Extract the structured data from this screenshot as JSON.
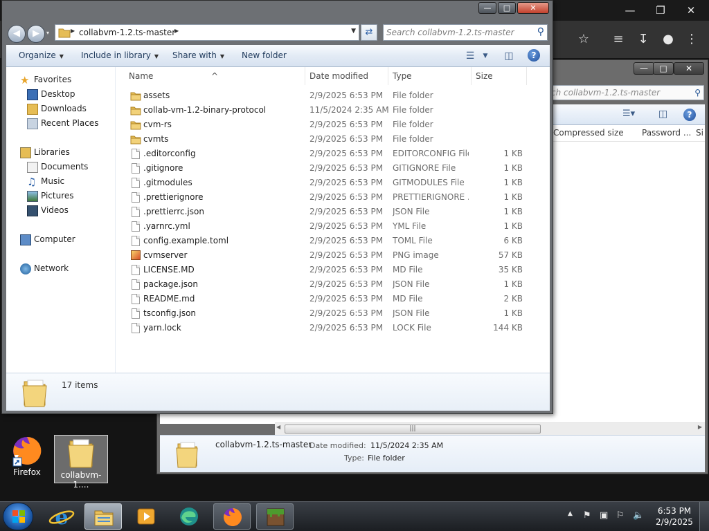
{
  "window": {
    "breadcrumb": "collabvm-1.2.ts-master",
    "search_placeholder": "Search collabvm-1.2.ts-master"
  },
  "toolbar": {
    "organize": "Organize",
    "include_in_library": "Include in library",
    "share_with": "Share with",
    "new_folder": "New folder",
    "help": "?"
  },
  "sidebar": {
    "favorites": "Favorites",
    "desktop": "Desktop",
    "downloads": "Downloads",
    "recent_places": "Recent Places",
    "libraries": "Libraries",
    "documents": "Documents",
    "music": "Music",
    "pictures": "Pictures",
    "videos": "Videos",
    "computer": "Computer",
    "network": "Network"
  },
  "columns": {
    "name": "Name",
    "date_modified": "Date modified",
    "type": "Type",
    "size": "Size"
  },
  "files": [
    {
      "name": "assets",
      "date": "2/9/2025 6:53 PM",
      "type": "File folder",
      "size": "",
      "kind": "folder"
    },
    {
      "name": "collab-vm-1.2-binary-protocol",
      "date": "11/5/2024 2:35 AM",
      "type": "File folder",
      "size": "",
      "kind": "folder"
    },
    {
      "name": "cvm-rs",
      "date": "2/9/2025 6:53 PM",
      "type": "File folder",
      "size": "",
      "kind": "folder"
    },
    {
      "name": "cvmts",
      "date": "2/9/2025 6:53 PM",
      "type": "File folder",
      "size": "",
      "kind": "folder"
    },
    {
      "name": ".editorconfig",
      "date": "2/9/2025 6:53 PM",
      "type": "EDITORCONFIG File",
      "size": "1 KB",
      "kind": "file"
    },
    {
      "name": ".gitignore",
      "date": "2/9/2025 6:53 PM",
      "type": "GITIGNORE File",
      "size": "1 KB",
      "kind": "file"
    },
    {
      "name": ".gitmodules",
      "date": "2/9/2025 6:53 PM",
      "type": "GITMODULES File",
      "size": "1 KB",
      "kind": "file"
    },
    {
      "name": ".prettierignore",
      "date": "2/9/2025 6:53 PM",
      "type": "PRETTIERIGNORE ...",
      "size": "1 KB",
      "kind": "file"
    },
    {
      "name": ".prettierrc.json",
      "date": "2/9/2025 6:53 PM",
      "type": "JSON File",
      "size": "1 KB",
      "kind": "file"
    },
    {
      "name": ".yarnrc.yml",
      "date": "2/9/2025 6:53 PM",
      "type": "YML File",
      "size": "1 KB",
      "kind": "file"
    },
    {
      "name": "config.example.toml",
      "date": "2/9/2025 6:53 PM",
      "type": "TOML File",
      "size": "6 KB",
      "kind": "file"
    },
    {
      "name": "cvmserver",
      "date": "2/9/2025 6:53 PM",
      "type": "PNG image",
      "size": "57 KB",
      "kind": "png"
    },
    {
      "name": "LICENSE.MD",
      "date": "2/9/2025 6:53 PM",
      "type": "MD File",
      "size": "35 KB",
      "kind": "file"
    },
    {
      "name": "package.json",
      "date": "2/9/2025 6:53 PM",
      "type": "JSON File",
      "size": "1 KB",
      "kind": "file"
    },
    {
      "name": "README.md",
      "date": "2/9/2025 6:53 PM",
      "type": "MD File",
      "size": "2 KB",
      "kind": "file"
    },
    {
      "name": "tsconfig.json",
      "date": "2/9/2025 6:53 PM",
      "type": "JSON File",
      "size": "1 KB",
      "kind": "file"
    },
    {
      "name": "yarn.lock",
      "date": "2/9/2025 6:53 PM",
      "type": "LOCK File",
      "size": "144 KB",
      "kind": "file"
    }
  ],
  "status": {
    "item_count": "17 items"
  },
  "back_window": {
    "search_text": "ch collabvm-1.2.ts-master",
    "col_compressed": "Compressed size",
    "col_password": "Password ...",
    "col_extra": "Si",
    "details_name": "collabvm-1.2.ts-master",
    "details_date_label": "Date modified:",
    "details_date_value": "11/5/2024 2:35 AM",
    "details_type_label": "Type:",
    "details_type_value": "File folder"
  },
  "desktop": {
    "firefox_label": "Firefox",
    "folder_label": "collabvm-1...."
  },
  "clock": {
    "time": "6:53 PM",
    "date": "2/9/2025"
  },
  "colors": {
    "selection_accent": "#cde8ff",
    "title_link": "#1e395b"
  }
}
